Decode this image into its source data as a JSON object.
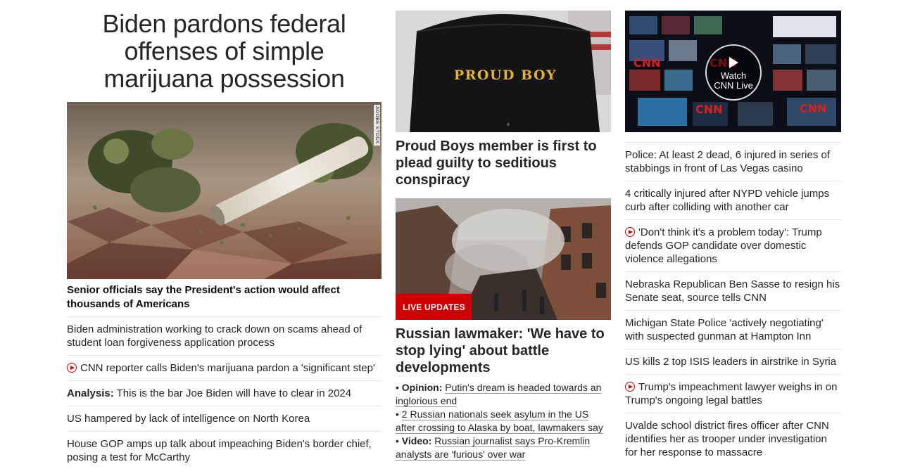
{
  "left": {
    "headline": "Biden pardons federal offenses of simple marijuana possession",
    "image_credit": "ADOBE STOCK",
    "subhead": "Senior officials say the President's action would affect thousands of Americans",
    "items": [
      {
        "text": "Biden administration working to crack down on scams ahead of student loan forgiveness application process"
      },
      {
        "video": true,
        "text": "CNN reporter calls Biden's marijuana pardon a 'significant step'"
      },
      {
        "label": "Analysis:",
        "text": " This is the bar Joe Biden will have to clear in 2024"
      },
      {
        "text": "US hampered by lack of intelligence on North Korea"
      },
      {
        "text": "House GOP amps up talk about impeaching Biden's border chief, posing a test for McCarthy"
      }
    ]
  },
  "middle": {
    "shirt_text": "PROUD BOY",
    "story1_headline": "Proud Boys member is first to plead guilty to seditious conspiracy",
    "live_badge": "LIVE UPDATES",
    "story2_headline": "Russian lawmaker: 'We have to stop lying' about battle developments",
    "bullets": [
      {
        "label": "Opinion:",
        "text": "Putin's dream is headed towards an inglorious end"
      },
      {
        "label": "",
        "text": "2 Russian nationals seek asylum in the US after crossing to Alaska by boat, lawmakers say"
      },
      {
        "label": "Video:",
        "text": "Russian journalist says Pro-Kremlin analysts are 'furious' over war"
      }
    ]
  },
  "right": {
    "watch_label_1": "Watch",
    "watch_label_2": "CNN Live",
    "items": [
      {
        "text": "Police: At least 2 dead, 6 injured in series of stabbings in front of Las Vegas casino"
      },
      {
        "text": "4 critically injured after NYPD vehicle jumps curb after colliding with another car"
      },
      {
        "video": true,
        "text": "'Don't think it's a problem today': Trump defends GOP candidate over domestic violence allegations"
      },
      {
        "text": "Nebraska Republican Ben Sasse to resign his Senate seat, source tells CNN"
      },
      {
        "text": "Michigan State Police 'actively negotiating' with suspected gunman at Hampton Inn"
      },
      {
        "text": "US kills 2 top ISIS leaders in airstrike in Syria"
      },
      {
        "video": true,
        "text": "Trump's impeachment lawyer weighs in on Trump's ongoing legal battles"
      },
      {
        "text": "Uvalde school district fires officer after CNN identifies her as trooper under investigation for her response to massacre"
      }
    ]
  },
  "colors": {
    "accent": "#cc0000",
    "divider": "#e6e6e6",
    "text": "#262626"
  }
}
